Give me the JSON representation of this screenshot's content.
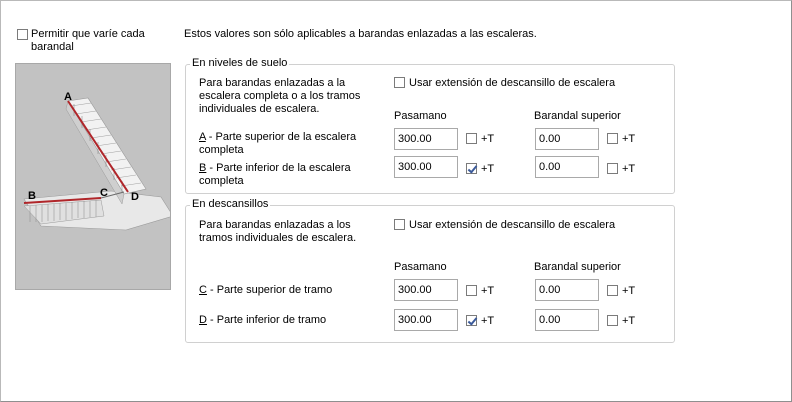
{
  "allow_vary": {
    "label": "Permitir que varíe cada barandal",
    "checked": false
  },
  "info_text": "Estos valores son sólo aplicables a barandas enlazadas a las escaleras.",
  "illustration": {
    "label_a": "A",
    "label_b": "B",
    "label_c": "C",
    "label_d": "D"
  },
  "floor_group": {
    "title": "En niveles de suelo",
    "description": "Para barandas enlazadas a la escalera completa o a los tramos individuales de escalera.",
    "use_extension_label": "Usar extensión de descansillo de escalera",
    "use_extension_checked": false,
    "col_handrail": "Pasamano",
    "col_top_rail": "Barandal superior",
    "rows": [
      {
        "key": "A",
        "label": " - Parte superior de la escalera completa",
        "handrail": "300.00",
        "handrail_t": false,
        "top_rail": "0.00",
        "top_rail_t": false
      },
      {
        "key": "B",
        "label": " - Parte inferior de la escalera completa",
        "handrail": "300.00",
        "handrail_t": true,
        "top_rail": "0.00",
        "top_rail_t": false
      }
    ],
    "plus_t": "+T"
  },
  "landing_group": {
    "title": "En descansillos",
    "description": "Para barandas enlazadas a los tramos individuales de escalera.",
    "use_extension_label": "Usar extensión de descansillo de escalera",
    "use_extension_checked": false,
    "col_handrail": "Pasamano",
    "col_top_rail": "Barandal superior",
    "rows": [
      {
        "key": "C",
        "label": " - Parte superior de tramo",
        "handrail": "300.00",
        "handrail_t": false,
        "top_rail": "0.00",
        "top_rail_t": false
      },
      {
        "key": "D",
        "label": " - Parte inferior de tramo",
        "handrail": "300.00",
        "handrail_t": true,
        "top_rail": "0.00",
        "top_rail_t": false
      }
    ],
    "plus_t": "+T"
  }
}
